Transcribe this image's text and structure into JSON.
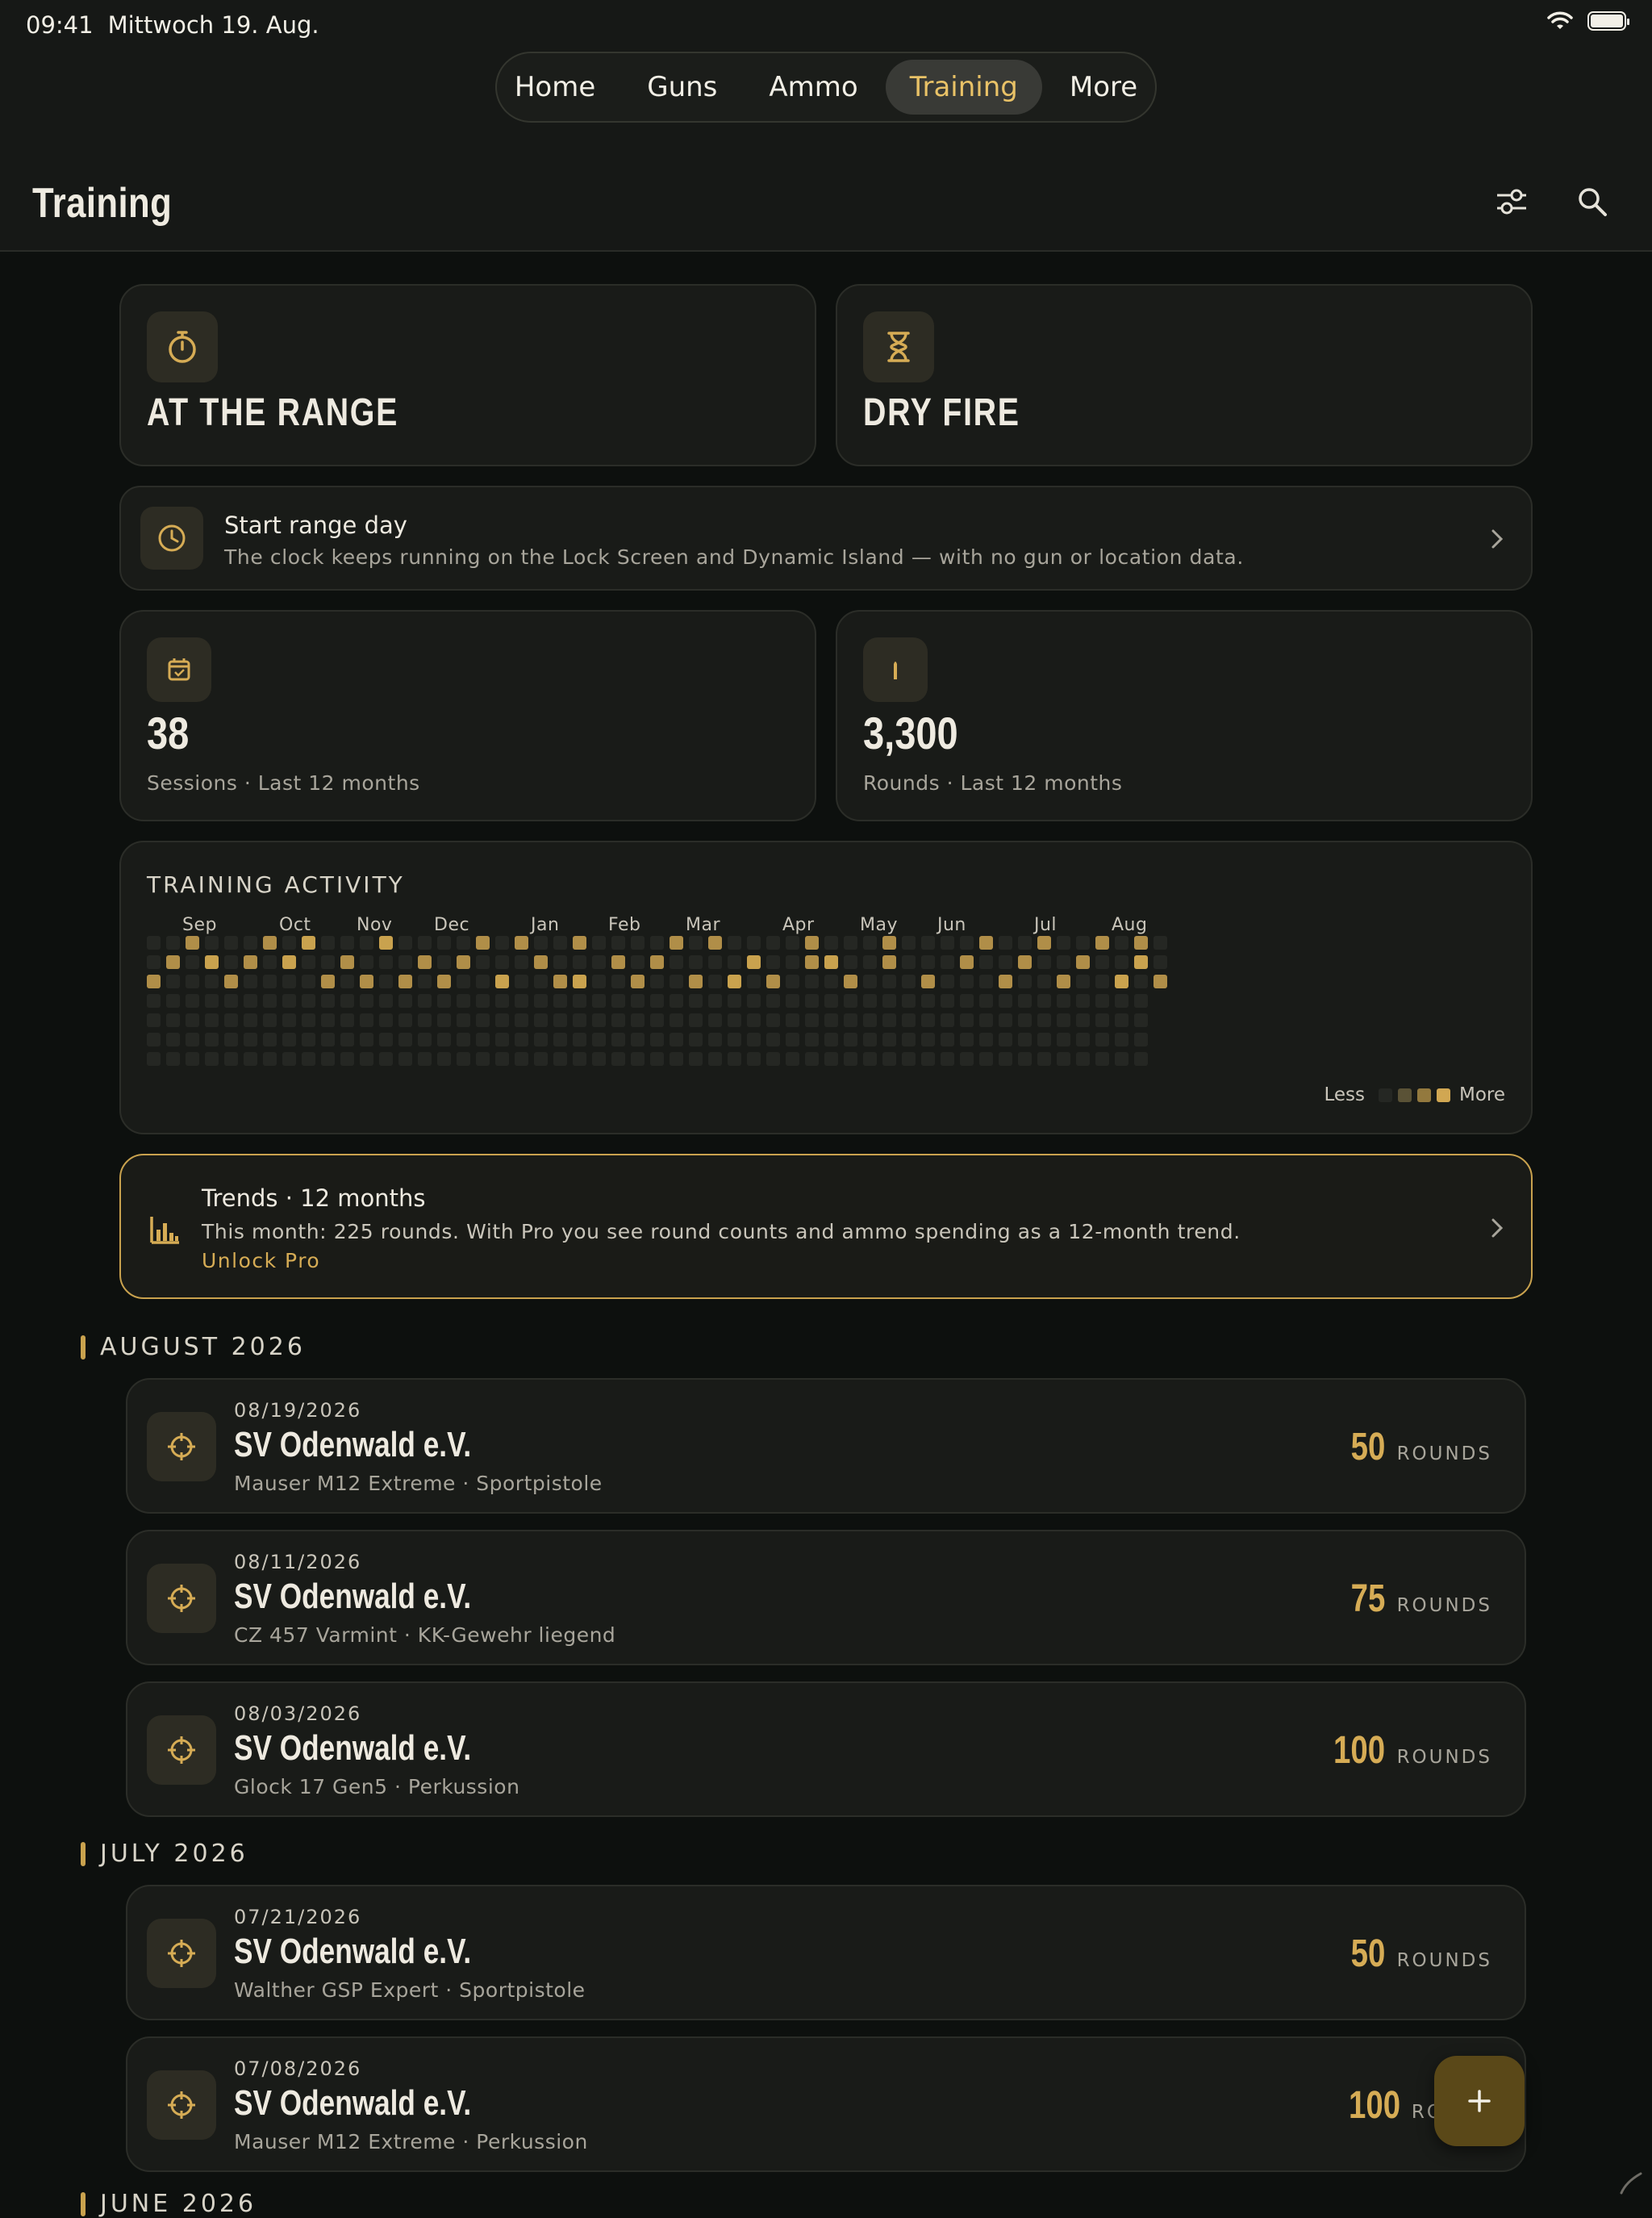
{
  "status": {
    "time": "09:41",
    "date": "Mittwoch 19. Aug."
  },
  "nav": {
    "tabs": [
      "Home",
      "Guns",
      "Ammo",
      "Training",
      "More"
    ],
    "active": "Training"
  },
  "header": {
    "title": "Training"
  },
  "modes": {
    "range": "AT THE RANGE",
    "dry": "DRY FIRE"
  },
  "rangeday": {
    "title": "Start range day",
    "subtitle": "The clock keeps running on the Lock Screen and Dynamic Island — with no gun or location data."
  },
  "stats": {
    "sessions": {
      "value": "38",
      "label": "Sessions · Last 12 months"
    },
    "rounds": {
      "value": "3,300",
      "label": "Rounds · Last 12 months"
    }
  },
  "activity": {
    "title": "TRAINING ACTIVITY",
    "months": [
      "Sep",
      "Oct",
      "Nov",
      "Dec",
      "Jan",
      "Feb",
      "Mar",
      "Apr",
      "May",
      "Jun",
      "Jul",
      "Aug"
    ],
    "legend_less": "Less",
    "legend_more": "More"
  },
  "trends": {
    "title": "Trends · 12 months",
    "body": "This month: 225 rounds. With Pro you see round counts and ammo spending as a 12-month trend.",
    "cta": "Unlock Pro"
  },
  "sections": [
    {
      "header": "AUGUST 2026",
      "entries": [
        {
          "date": "08/19/2026",
          "club": "SV Odenwald e.V.",
          "detail": "Mauser M12 Extreme · Sportpistole",
          "rounds": "50",
          "unit": "ROUNDS"
        },
        {
          "date": "08/11/2026",
          "club": "SV Odenwald e.V.",
          "detail": "CZ 457 Varmint · KK-Gewehr liegend",
          "rounds": "75",
          "unit": "ROUNDS"
        },
        {
          "date": "08/03/2026",
          "club": "SV Odenwald e.V.",
          "detail": "Glock 17 Gen5 · Perkussion",
          "rounds": "100",
          "unit": "ROUNDS"
        }
      ]
    },
    {
      "header": "JULY 2026",
      "entries": [
        {
          "date": "07/21/2026",
          "club": "SV Odenwald e.V.",
          "detail": "Walther GSP Expert · Sportpistole",
          "rounds": "50",
          "unit": "ROUNDS"
        },
        {
          "date": "07/08/2026",
          "club": "SV Odenwald e.V.",
          "detail": "Mauser M12 Extreme · Perkussion",
          "rounds": "100",
          "unit": "RO"
        }
      ]
    },
    {
      "header": "JUNE 2026"
    }
  ],
  "colors": {
    "accent": "#d6ac55",
    "background": "#0d100e",
    "card": "#191b18"
  }
}
